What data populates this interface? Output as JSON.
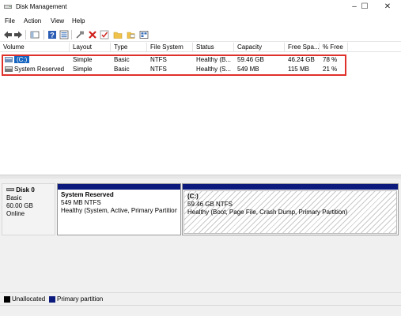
{
  "window": {
    "title": "Disk Management",
    "app_icon": "disk-management-icon",
    "controls": {
      "minimize": "–",
      "maximize": "☐",
      "close": "✕"
    }
  },
  "menu": [
    "File",
    "Action",
    "View",
    "Help"
  ],
  "toolbar": {
    "icons": [
      "back-arrow-icon",
      "forward-arrow-icon",
      "show-hide-console-tree-icon",
      "help-icon",
      "properties-icon",
      "connect-disk-icon",
      "delete-icon",
      "check-icon",
      "folder-icon",
      "folder-open-icon",
      "view-icon"
    ]
  },
  "volume_table": {
    "headers": [
      "Volume",
      "Layout",
      "Type",
      "File System",
      "Status",
      "Capacity",
      "Free Spa...",
      "% Free"
    ],
    "rows": [
      {
        "volume": "(C:)",
        "layout": "Simple",
        "type": "Basic",
        "fs": "NTFS",
        "status": "Healthy (B...",
        "capacity": "59.46 GB",
        "free": "46.24 GB",
        "pct": "78 %"
      },
      {
        "volume": "System Reserved",
        "layout": "Simple",
        "type": "Basic",
        "fs": "NTFS",
        "status": "Healthy (S...",
        "capacity": "549 MB",
        "free": "115 MB",
        "pct": "21 %"
      }
    ],
    "highlight_color": "#e0302a"
  },
  "disk": {
    "name": "Disk 0",
    "type": "Basic",
    "size": "60.00 GB",
    "state": "Online",
    "partitions": [
      {
        "name": "System Reserved",
        "size_fs": "549 MB NTFS",
        "status": "Healthy (System, Active, Primary Partition)"
      },
      {
        "name": "(C:)",
        "size_fs": "59.46 GB NTFS",
        "status": "Healthy (Boot, Page File, Crash Dump, Primary Partition)"
      }
    ]
  },
  "legend": {
    "unallocated": "Unallocated",
    "primary": "Primary partition",
    "colors": {
      "unallocated": "#000000",
      "primary": "#0c1a7d"
    }
  }
}
